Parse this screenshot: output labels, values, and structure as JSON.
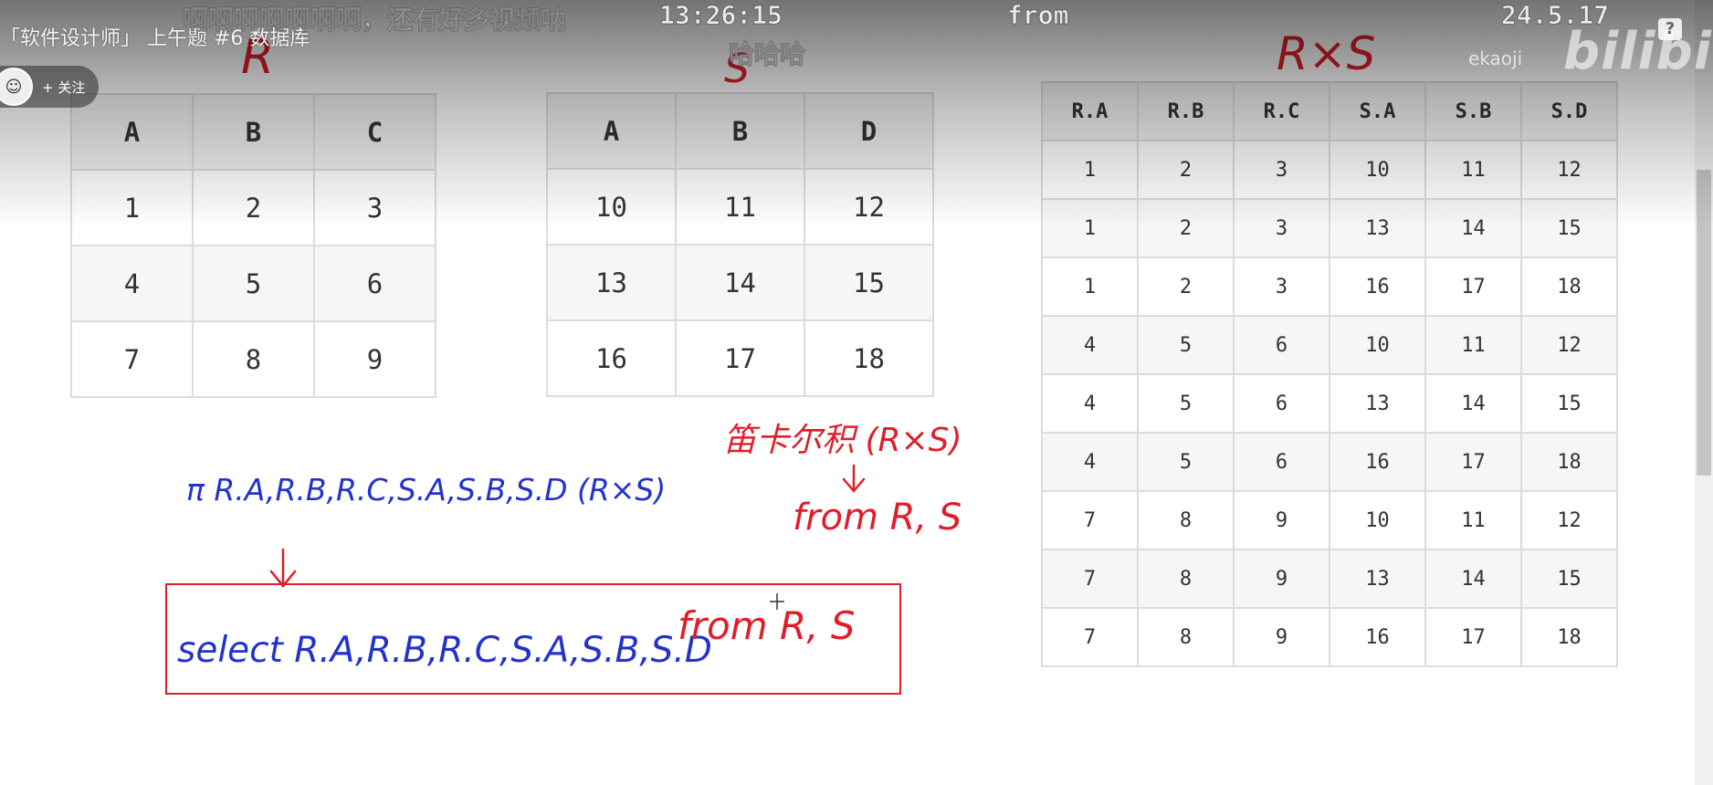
{
  "video_overlay": {
    "title": "「软件设计师」 上午题 #6 数据库",
    "follow_label": "+ 关注",
    "help_label": "?",
    "brand_text": "bilibili",
    "brand_user": "ekaoji"
  },
  "danmaku": [
    {
      "id": "d1",
      "text": "啊啊啊啊啊啊啊，还有好多视频呐"
    },
    {
      "id": "d2",
      "text": "13:26:15"
    },
    {
      "id": "d3",
      "text": "from"
    },
    {
      "id": "d4",
      "text": "24.5.17"
    },
    {
      "id": "d5",
      "text": "哈哈哈"
    }
  ],
  "handwritten": {
    "label_r": "R",
    "label_s": "S",
    "label_rxs": "R×S",
    "projection": "π R.A,R.B,R.C,S.A,S.B,S.D (R×S)",
    "cartesian_note": "笛卡尔积 (R×S)",
    "from_note": "from R, S",
    "select_part": "select R.A,R.B,R.C,S.A,S.B,S.D",
    "from_part": "from R, S",
    "colors": {
      "blue": "#2233cc",
      "red": "#e01e2a"
    }
  },
  "table_r": {
    "headers": [
      "A",
      "B",
      "C"
    ],
    "rows": [
      [
        "1",
        "2",
        "3"
      ],
      [
        "4",
        "5",
        "6"
      ],
      [
        "7",
        "8",
        "9"
      ]
    ]
  },
  "table_s": {
    "headers": [
      "A",
      "B",
      "D"
    ],
    "rows": [
      [
        "10",
        "11",
        "12"
      ],
      [
        "13",
        "14",
        "15"
      ],
      [
        "16",
        "17",
        "18"
      ]
    ]
  },
  "table_rxs": {
    "headers": [
      "R.A",
      "R.B",
      "R.C",
      "S.A",
      "S.B",
      "S.D"
    ],
    "rows": [
      [
        "1",
        "2",
        "3",
        "10",
        "11",
        "12"
      ],
      [
        "1",
        "2",
        "3",
        "13",
        "14",
        "15"
      ],
      [
        "1",
        "2",
        "3",
        "16",
        "17",
        "18"
      ],
      [
        "4",
        "5",
        "6",
        "10",
        "11",
        "12"
      ],
      [
        "4",
        "5",
        "6",
        "13",
        "14",
        "15"
      ],
      [
        "4",
        "5",
        "6",
        "16",
        "17",
        "18"
      ],
      [
        "7",
        "8",
        "9",
        "10",
        "11",
        "12"
      ],
      [
        "7",
        "8",
        "9",
        "13",
        "14",
        "15"
      ],
      [
        "7",
        "8",
        "9",
        "16",
        "17",
        "18"
      ]
    ]
  }
}
